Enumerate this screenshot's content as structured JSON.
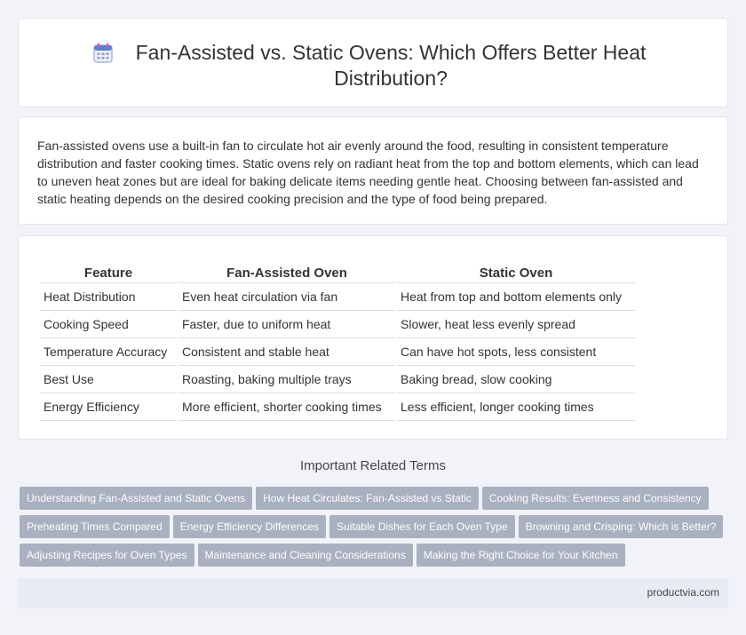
{
  "header": {
    "title": "Fan-Assisted vs. Static Ovens: Which Offers Better Heat Distribution?",
    "icon": "calendar-icon"
  },
  "intro": {
    "text": "Fan-assisted ovens use a built-in fan to circulate hot air evenly around the food, resulting in consistent temperature distribution and faster cooking times. Static ovens rely on radiant heat from the top and bottom elements, which can lead to uneven heat zones but are ideal for baking delicate items needing gentle heat. Choosing between fan-assisted and static heating depends on the desired cooking precision and the type of food being prepared."
  },
  "table": {
    "headers": [
      "Feature",
      "Fan-Assisted Oven",
      "Static Oven"
    ],
    "rows": [
      [
        "Heat Distribution",
        "Even heat circulation via fan",
        "Heat from top and bottom elements only"
      ],
      [
        "Cooking Speed",
        "Faster, due to uniform heat",
        "Slower, heat less evenly spread"
      ],
      [
        "Temperature Accuracy",
        "Consistent and stable heat",
        "Can have hot spots, less consistent"
      ],
      [
        "Best Use",
        "Roasting, baking multiple trays",
        "Baking bread, slow cooking"
      ],
      [
        "Energy Efficiency",
        "More efficient, shorter cooking times",
        "Less efficient, longer cooking times"
      ]
    ]
  },
  "related": {
    "title": "Important Related Terms",
    "tags": [
      "Understanding Fan-Assisted and Static Ovens",
      "How Heat Circulates: Fan-Assisted vs Static",
      "Cooking Results: Evenness and Consistency",
      "Preheating Times Compared",
      "Energy Efficiency Differences",
      "Suitable Dishes for Each Oven Type",
      "Browning and Crisping: Which is Better?",
      "Adjusting Recipes for Oven Types",
      "Maintenance and Cleaning Considerations",
      "Making the Right Choice for Your Kitchen"
    ]
  },
  "footer": {
    "site": "productvia.com"
  },
  "colors": {
    "background": "#f1f3f8",
    "tag": "#a9b0bf",
    "footer": "#e8ebf4",
    "icon_accent": "#5b7fd6"
  }
}
